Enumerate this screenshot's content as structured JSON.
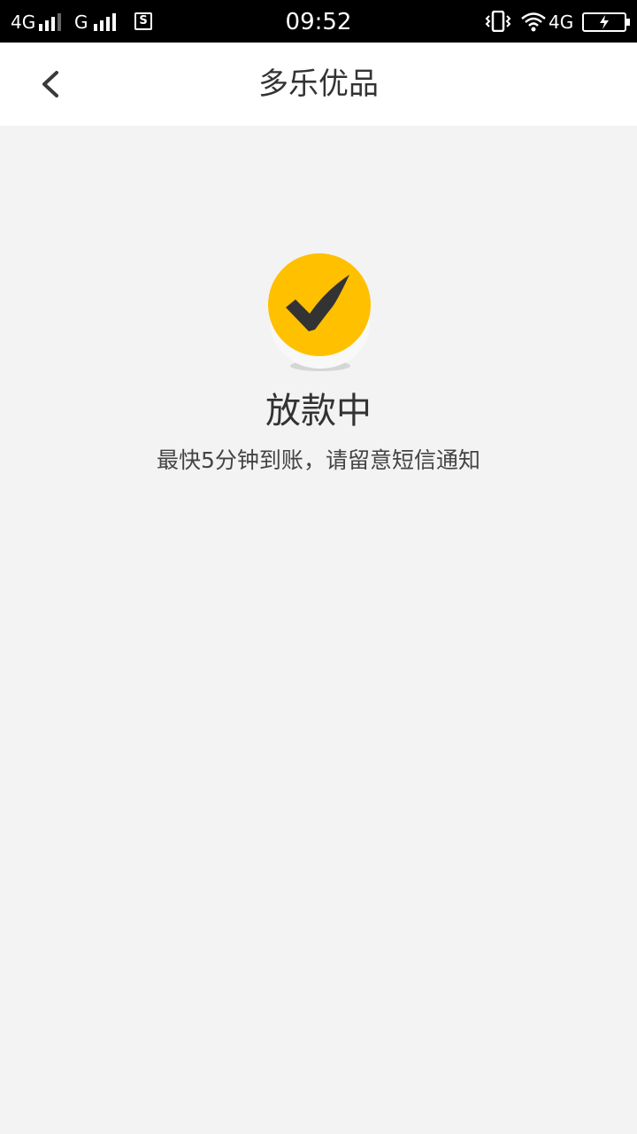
{
  "status_bar": {
    "network_1": "4G",
    "network_2": "G",
    "sim_label": "S",
    "time": "09:52",
    "network_3": "4G"
  },
  "nav": {
    "title": "多乐优品"
  },
  "status": {
    "heading": "放款中",
    "description": "最快5分钟到账，请留意短信通知",
    "accent_color": "#ffc000"
  }
}
